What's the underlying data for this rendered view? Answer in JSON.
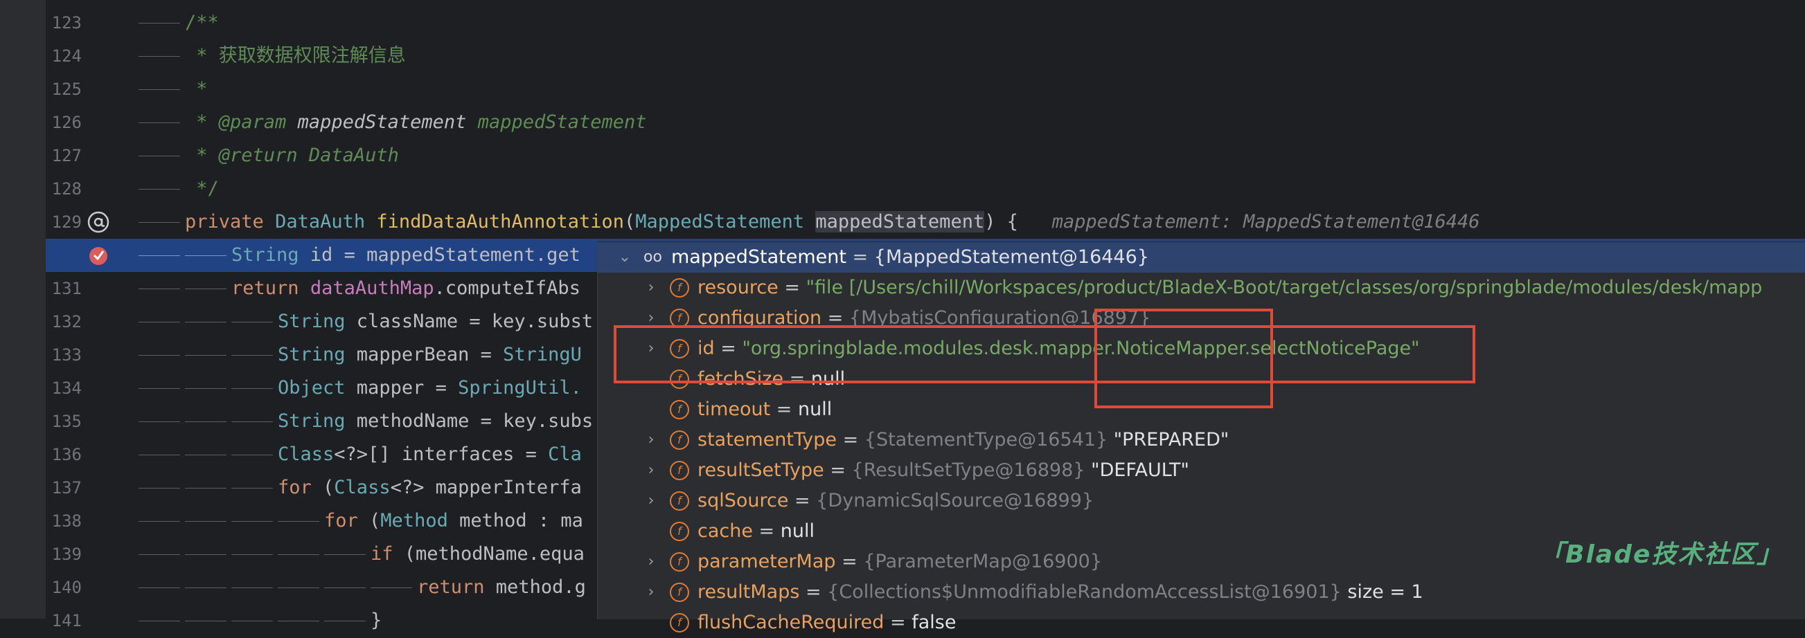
{
  "editor": {
    "lines": [
      {
        "num": "123",
        "text": "/**"
      },
      {
        "num": "124",
        "text": " * 获取数据权限注解信息"
      },
      {
        "num": "125",
        "text": " *"
      },
      {
        "num": "126",
        "text": " * @param mappedStatement mappedStatement",
        "tag": "@param",
        "ref": "mappedStatement",
        "desc": "mappedStatement"
      },
      {
        "num": "127",
        "text": " * @return DataAuth",
        "tag": "@return",
        "desc": "DataAuth"
      },
      {
        "num": "128",
        "text": " */"
      },
      {
        "num": "129",
        "kw": "private",
        "type": "DataAuth",
        "fn": "findDataAuthAnnotation",
        "ptype": "MappedStatement",
        "param": "mappedStatement",
        "hint": "mappedStatement: MappedStatement@16446"
      },
      {
        "num": "",
        "kw": "String",
        "rest": " id = mappedStatement.get"
      },
      {
        "num": "131",
        "kw": "return",
        "field": "dataAuthMap",
        "rest": ".computeIfAbs"
      },
      {
        "num": "132",
        "type": "String",
        "rest": " className = key.subst"
      },
      {
        "num": "133",
        "type": "String",
        "rest": " mapperBean = ",
        "cls": "StringU"
      },
      {
        "num": "134",
        "type": "Object",
        "rest": " mapper = ",
        "cls": "SpringUtil."
      },
      {
        "num": "135",
        "type": "String",
        "rest": " methodName = key.subs"
      },
      {
        "num": "136",
        "type": "Class",
        "rest": "<?>[] interfaces = ",
        "cls": "Cla"
      },
      {
        "num": "137",
        "kw": "for",
        "rest": " (",
        "type": "Class",
        "rest2": "<?> mapperInterfa"
      },
      {
        "num": "138",
        "kw": "for",
        "rest": " (",
        "type": "Method",
        "rest2": " method : ma"
      },
      {
        "num": "139",
        "kw": "if",
        "rest": " (methodName.equa"
      },
      {
        "num": "140",
        "kw": "return",
        "rest": " method.g"
      },
      {
        "num": "141",
        "rest": "}"
      }
    ]
  },
  "debug": {
    "header": {
      "name": "mappedStatement",
      "eq": " = ",
      "value": "{MappedStatement@16446}"
    },
    "rows": [
      {
        "name": "resource",
        "eq": " = ",
        "str": "\"file [/Users/chill/Workspaces/product/BladeX-Boot/target/classes/org/springblade/modules/desk/mapp"
      },
      {
        "name": "configuration",
        "eq": " = ",
        "ref": "{MybatisConfiguration@16897}"
      },
      {
        "name": "id",
        "eq": " = ",
        "str": "\"org.springblade.modules.desk.mapper.NoticeMapper.selectNoticePage\""
      },
      {
        "name": "fetchSize",
        "eq": " = ",
        "plain": "null"
      },
      {
        "name": "timeout",
        "eq": " = ",
        "plain": "null"
      },
      {
        "name": "statementType",
        "eq": " = ",
        "ref": "{StatementType@16541}",
        "plain": " \"PREPARED\""
      },
      {
        "name": "resultSetType",
        "eq": " = ",
        "ref": "{ResultSetType@16898}",
        "plain": " \"DEFAULT\""
      },
      {
        "name": "sqlSource",
        "eq": " = ",
        "ref": "{DynamicSqlSource@16899}"
      },
      {
        "name": "cache",
        "eq": " = ",
        "plain": "null"
      },
      {
        "name": "parameterMap",
        "eq": " = ",
        "ref": "{ParameterMap@16900}"
      },
      {
        "name": "resultMaps",
        "eq": " = ",
        "ref": "{Collections$UnmodifiableRandomAccessList@16901}",
        "plain": "  size = 1"
      },
      {
        "name": "flushCacheRequired",
        "eq": " = ",
        "plain": "false"
      }
    ],
    "field_icon_letter": "f"
  },
  "watermark": "「Blade技术社区」",
  "colors": {
    "accent_box": "#e04a3a",
    "current_line": "#214283",
    "header_row": "#2e436e"
  }
}
